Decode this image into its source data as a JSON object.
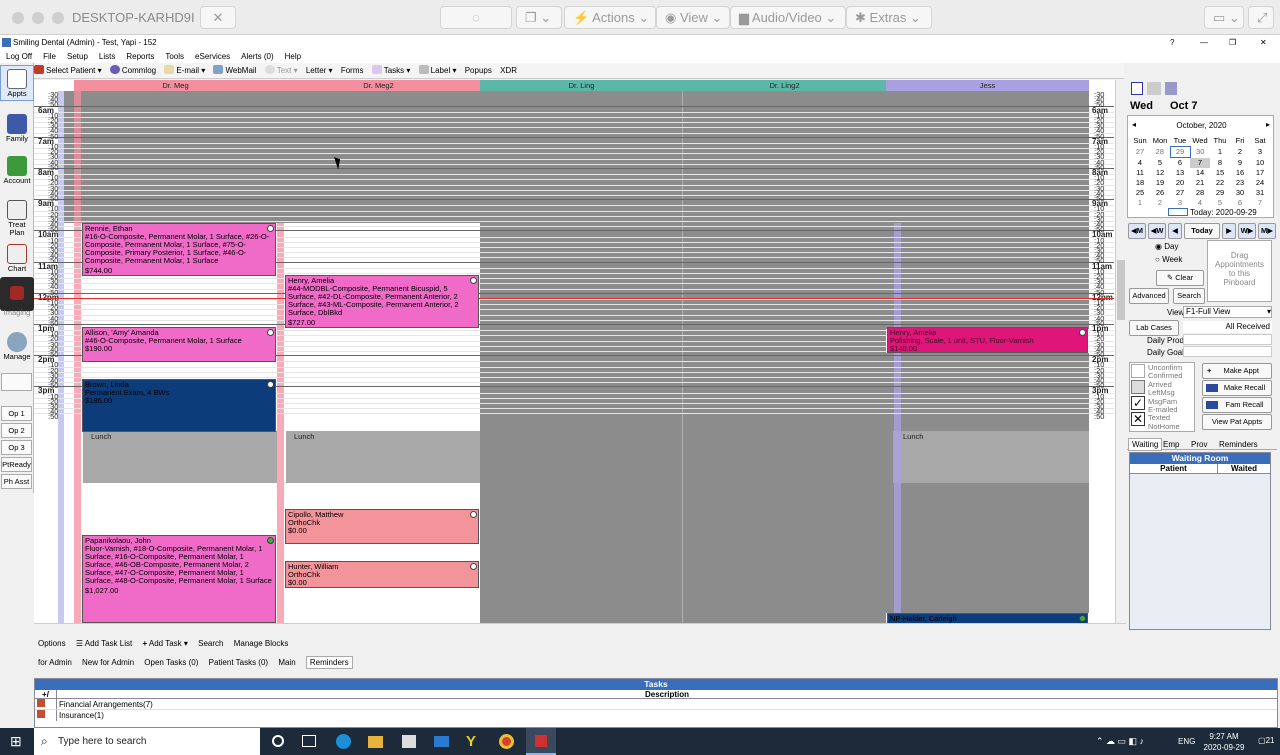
{
  "remote": {
    "host": "DESKTOP-KARHD9I",
    "actions": "Actions",
    "view": "View",
    "audio": "Audio/Video",
    "extras": "Extras"
  },
  "app": {
    "title": "Smiling Dental (Admin) - Test, Yapi - 152",
    "help": "?"
  },
  "menu": [
    "Log Off",
    "File",
    "Setup",
    "Lists",
    "Reports",
    "Tools",
    "eServices",
    "Alerts (0)",
    "Help"
  ],
  "toolbar": [
    "Select Patient",
    "Commlog",
    "E-mail",
    "WebMail",
    "Text",
    "Letter",
    "Forms",
    "Tasks",
    "Label",
    "Popups",
    "XDR"
  ],
  "modules": [
    "Appts",
    "Family",
    "Account",
    "Treat Plan",
    "Chart",
    "Imaging",
    "Manage"
  ],
  "ops": [
    "Op 1",
    "Op 2",
    "Op 3",
    "PtReady",
    "Ph Asst"
  ],
  "providers": [
    "Dr. Meg",
    "Dr. Meg2",
    "Dr. Ling",
    "Dr. Ling2",
    "Jess"
  ],
  "times": {
    "top": [
      ":30",
      ":40",
      ":50"
    ],
    "h6": "6am",
    "h7": "7am",
    "h8": "8am",
    "h9": "9am",
    "h10": "10am",
    "h11": "11am",
    "h12": "12pm",
    "h1": "1pm",
    "h2": "2pm",
    "h3": "3pm",
    "minutes": [
      ":10",
      ":20",
      ":30",
      ":40",
      ":50"
    ]
  },
  "appointments": {
    "rennie": {
      "name": "Rennie, Ethan",
      "proc": "#16-O-Composite, Permanent Molar, 1 Surface, #26-O-Composite, Permanent Molar, 1 Surface, #75-O-Composite, Primary Posterior, 1 Surface, #46-O-Composite, Permanent Molar, 1 Surface",
      "fee": "$744.00"
    },
    "henry": {
      "name": "Henry, Amelia",
      "proc": "#44-MODBL-Composite, Permanent Bicuspid, 5 Surface, #42-DL-Composite, Permanent Anterior, 2 Surface, #43-ML-Composite, Permanent Anterior, 2 Surface, DblBkd",
      "fee": "$727.00"
    },
    "allison": {
      "name": "Allison, 'Amy' Amanda",
      "proc": "#46-O-Composite, Permanent Molar, 1 Surface",
      "fee": "$190.00"
    },
    "henry2": {
      "name": "Henry, Amelia",
      "proc": "Polishing, Scale, 1 unit, STU, Fluor-Varnish",
      "fee": "$140.00"
    },
    "brown": {
      "name": "Brown, Linda",
      "proc": "Permanent Exam, 4 BWs",
      "fee": "$186.00"
    },
    "cipollo": {
      "name": "Cipollo, Matthew",
      "proc": "OrthoChk",
      "fee": "$0.00"
    },
    "papanikolaou": {
      "name": "Papanikolaou, John",
      "proc": "Fluor-Varnish, #18-O-Composite, Permanent Molar, 1 Surface, #16-O-Composite, Permanent Molar, 1 Surface, #46-OB-Composite, Permanent Molar, 2 Surface, #47-O-Composite, Permanent Molar, 1 Surface, #48-O-Composite, Permanent Molar, 1 Surface",
      "fee": "$1,027.00"
    },
    "hunter": {
      "name": "Hunter, William",
      "proc": "OrthoChk",
      "fee": "$0.00"
    },
    "holder": {
      "name": "NP-Holder, Carleigh"
    },
    "lunch": "Lunch"
  },
  "calendar": {
    "weekday": "Wed",
    "date": "Oct 7",
    "month": "October, 2020",
    "days": [
      "Sun",
      "Mon",
      "Tue",
      "Wed",
      "Thu",
      "Fri",
      "Sat"
    ],
    "weeks": [
      [
        "27",
        "28",
        "29",
        "30",
        "1",
        "2",
        "3"
      ],
      [
        "4",
        "5",
        "6",
        "7",
        "8",
        "9",
        "10"
      ],
      [
        "11",
        "12",
        "13",
        "14",
        "15",
        "16",
        "17"
      ],
      [
        "18",
        "19",
        "20",
        "21",
        "22",
        "23",
        "24"
      ],
      [
        "25",
        "26",
        "27",
        "28",
        "29",
        "30",
        "31"
      ],
      [
        "1",
        "2",
        "3",
        "4",
        "5",
        "6",
        "7"
      ]
    ],
    "today": "Today: 2020-09-29"
  },
  "nav": {
    "m": "M",
    "w": "W",
    "today": "Today"
  },
  "side": {
    "day": "Day",
    "week": "Week",
    "clear": "Clear",
    "advanced": "Advanced",
    "search": "Search",
    "pinboard": "Drag Appointments to this Pinboard",
    "view_label": "View",
    "view_value": "F1-Full View",
    "lab_cases": "Lab Cases",
    "all_received": "All Received",
    "daily_prod": "Daily Prod",
    "daily_goal": "Daily Goal",
    "statuses": [
      "Unconfirm",
      "Confirmed",
      "Arrived",
      "LeftMsg",
      "MsgFam",
      "E-mailed",
      "Texted",
      "NotHome"
    ],
    "make_appt": "Make Appt",
    "make_recall": "Make Recall",
    "fam_recall": "Fam Recall",
    "view_pat_appts": "View Pat Appts",
    "tabs": [
      "Waiting",
      "Emp",
      "Prov",
      "Reminders"
    ],
    "waiting_room": "Waiting Room",
    "patient": "Patient",
    "waited": "Waited"
  },
  "bottom": {
    "options": "Options",
    "add_task_list": "Add Task List",
    "add_task": "Add Task",
    "search": "Search",
    "manage_blocks": "Manage Blocks",
    "tabs": [
      "for Admin",
      "New for Admin",
      "Open Tasks (0)",
      "Patient Tasks (0)",
      "Main",
      "Reminders"
    ],
    "tasks_title": "Tasks",
    "plus": "+/",
    "description": "Description",
    "rows": [
      "Financial Arrangements(7)",
      "Insurance(1)"
    ]
  },
  "winbar": {
    "search": "Type here to search",
    "time": "9:27 AM",
    "date": "2020-09-29",
    "lang": "ENG",
    "notif": "21"
  },
  "colors": {
    "meg": "#f48fa0",
    "meg2": "#f48fa0",
    "ling": "#5bb8a8",
    "jess": "#a8a0e0",
    "appt_pink": "#f06ac8",
    "appt_salmon": "#f3939a",
    "appt_navy": "#0d3c7a",
    "appt_magenta": "#e0157a",
    "closed": "#8c8c8c"
  }
}
